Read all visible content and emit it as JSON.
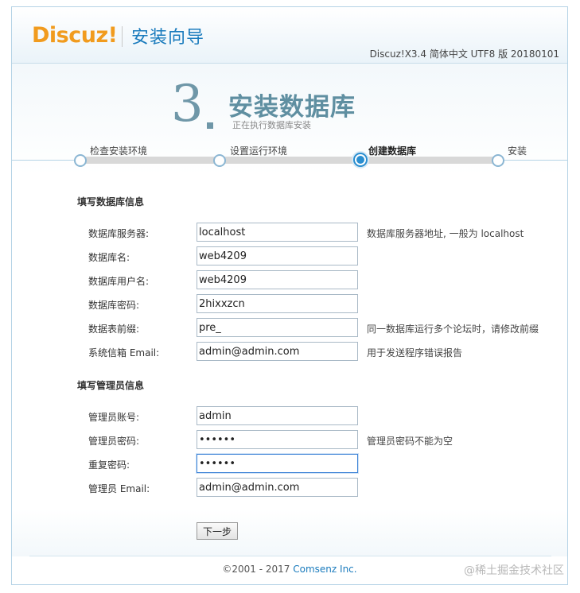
{
  "header": {
    "logo": "Discuz!",
    "title": "安装向导",
    "version": "Discuz!X3.4 简体中文 UTF8 版 20180101"
  },
  "step": {
    "number": "3",
    "title": "安装数据库",
    "subtitle": "正在执行数据库安装"
  },
  "progress": {
    "steps": [
      {
        "label": "检查安装环境"
      },
      {
        "label": "设置运行环境"
      },
      {
        "label": "创建数据库"
      },
      {
        "label": "安装"
      }
    ],
    "active_index": 2
  },
  "db_section": {
    "title": "填写数据库信息",
    "fields": [
      {
        "label": "数据库服务器:",
        "value": "localhost",
        "note": "数据库服务器地址, 一般为 localhost"
      },
      {
        "label": "数据库名:",
        "value": "web4209",
        "note": ""
      },
      {
        "label": "数据库用户名:",
        "value": "web4209",
        "note": ""
      },
      {
        "label": "数据库密码:",
        "value": "2hixxzcn",
        "note": ""
      },
      {
        "label": "数据表前缀:",
        "value": "pre_",
        "note": "同一数据库运行多个论坛时，请修改前缀"
      },
      {
        "label": "系统信箱 Email:",
        "value": "admin@admin.com",
        "note": "用于发送程序错误报告"
      }
    ]
  },
  "admin_section": {
    "title": "填写管理员信息",
    "fields": [
      {
        "label": "管理员账号:",
        "value": "admin",
        "note": ""
      },
      {
        "label": "管理员密码:",
        "value": "••••••",
        "note": "管理员密码不能为空"
      },
      {
        "label": "重复密码:",
        "value": "••••••",
        "note": ""
      },
      {
        "label": "管理员 Email:",
        "value": "admin@admin.com",
        "note": ""
      }
    ]
  },
  "buttons": {
    "next": "下一步"
  },
  "footer": {
    "copyright": "©2001 - 2017",
    "brand": "Comsenz Inc."
  },
  "watermark": "@稀土掘金技术社区"
}
